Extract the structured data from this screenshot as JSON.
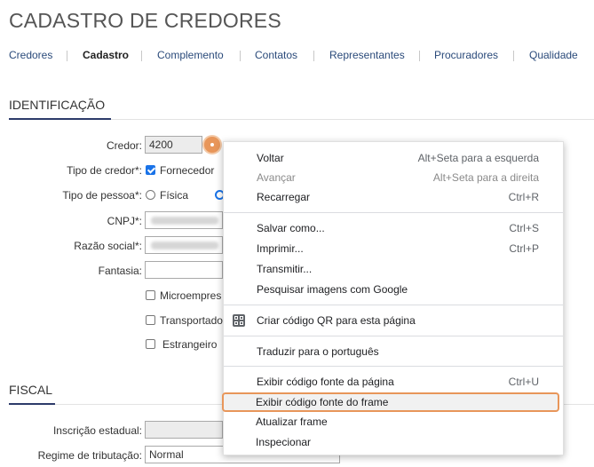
{
  "page": {
    "title": "CADASTRO DE CREDORES"
  },
  "tabs": [
    "Credores",
    "Cadastro",
    "Complemento",
    "Contatos",
    "Representantes",
    "Procuradores",
    "Qualidade"
  ],
  "sections": {
    "identificacao": "IDENTIFICAÇÃO",
    "fiscal": "FISCAL"
  },
  "form": {
    "credor": {
      "label": "Credor:",
      "value": "4200"
    },
    "tipo_credor": {
      "label": "Tipo de credor*:",
      "option": "Fornecedor",
      "checked": true
    },
    "tipo_pessoa": {
      "label": "Tipo de pessoa*:",
      "option_fisica": "Física"
    },
    "cnpj": {
      "label": "CNPJ*:"
    },
    "razao_social": {
      "label": "Razão social*:"
    },
    "fantasia": {
      "label": "Fantasia:",
      "value": ""
    },
    "microempresa": "Microempres",
    "transportadora": "Transportado",
    "estrangeiro": "Estrangeiro",
    "inscricao_estadual": {
      "label": "Inscrição estadual:"
    },
    "regime": {
      "label": "Regime de tributação:",
      "value": "Normal"
    }
  },
  "context_menu": {
    "items": [
      {
        "label": "Voltar",
        "shortcut": "Alt+Seta para a esquerda",
        "disabled": false
      },
      {
        "label": "Avançar",
        "shortcut": "Alt+Seta para a direita",
        "disabled": true
      },
      {
        "label": "Recarregar",
        "shortcut": "Ctrl+R",
        "disabled": false
      },
      {
        "label": "Salvar como...",
        "shortcut": "Ctrl+S"
      },
      {
        "label": "Imprimir...",
        "shortcut": "Ctrl+P"
      },
      {
        "label": "Transmitir..."
      },
      {
        "label": "Pesquisar imagens com Google"
      },
      {
        "label": "Criar código QR para esta página",
        "icon": "qr-code-icon"
      },
      {
        "label": "Traduzir para o português"
      },
      {
        "label": "Exibir código fonte da página",
        "shortcut": "Ctrl+U"
      },
      {
        "label": "Exibir código fonte do frame",
        "highlighted": true
      },
      {
        "label": "Atualizar frame"
      },
      {
        "label": "Inspecionar"
      }
    ]
  },
  "colors": {
    "accent": "#e8965a",
    "tab_link": "#2a4a7a",
    "section_underline": "#2d3b6a",
    "checkbox": "#1a73e8"
  }
}
